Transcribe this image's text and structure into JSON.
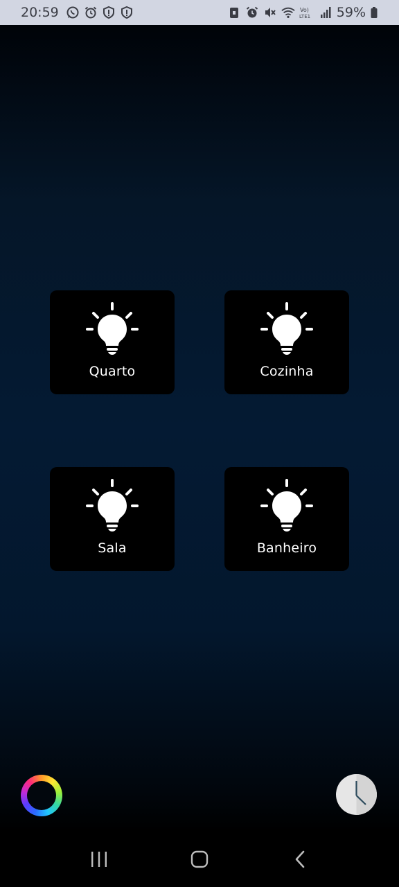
{
  "status_bar": {
    "time": "20:59",
    "left_icons": [
      "whatsapp-icon",
      "alarm-icon",
      "shield-alert-icon",
      "shield-alert-icon"
    ],
    "right_icons": [
      "lock-screen-icon",
      "alarm-icon",
      "mute-icon",
      "wifi-icon",
      "volte-icon",
      "signal-icon"
    ],
    "battery_percent": "59%"
  },
  "rooms": [
    {
      "label": "Quarto",
      "icon": "lightbulb-icon"
    },
    {
      "label": "Cozinha",
      "icon": "lightbulb-icon"
    },
    {
      "label": "Sala",
      "icon": "lightbulb-icon"
    },
    {
      "label": "Banheiro",
      "icon": "lightbulb-icon"
    }
  ],
  "bottom_controls": {
    "left": "color-wheel-icon",
    "right": "clock-icon"
  },
  "navigation": [
    "recents-icon",
    "home-icon",
    "back-icon"
  ],
  "colors": {
    "tile_background": "#000000",
    "status_bar_background": "#d2d6e2",
    "screen_gradient_mid": "#041a33"
  }
}
